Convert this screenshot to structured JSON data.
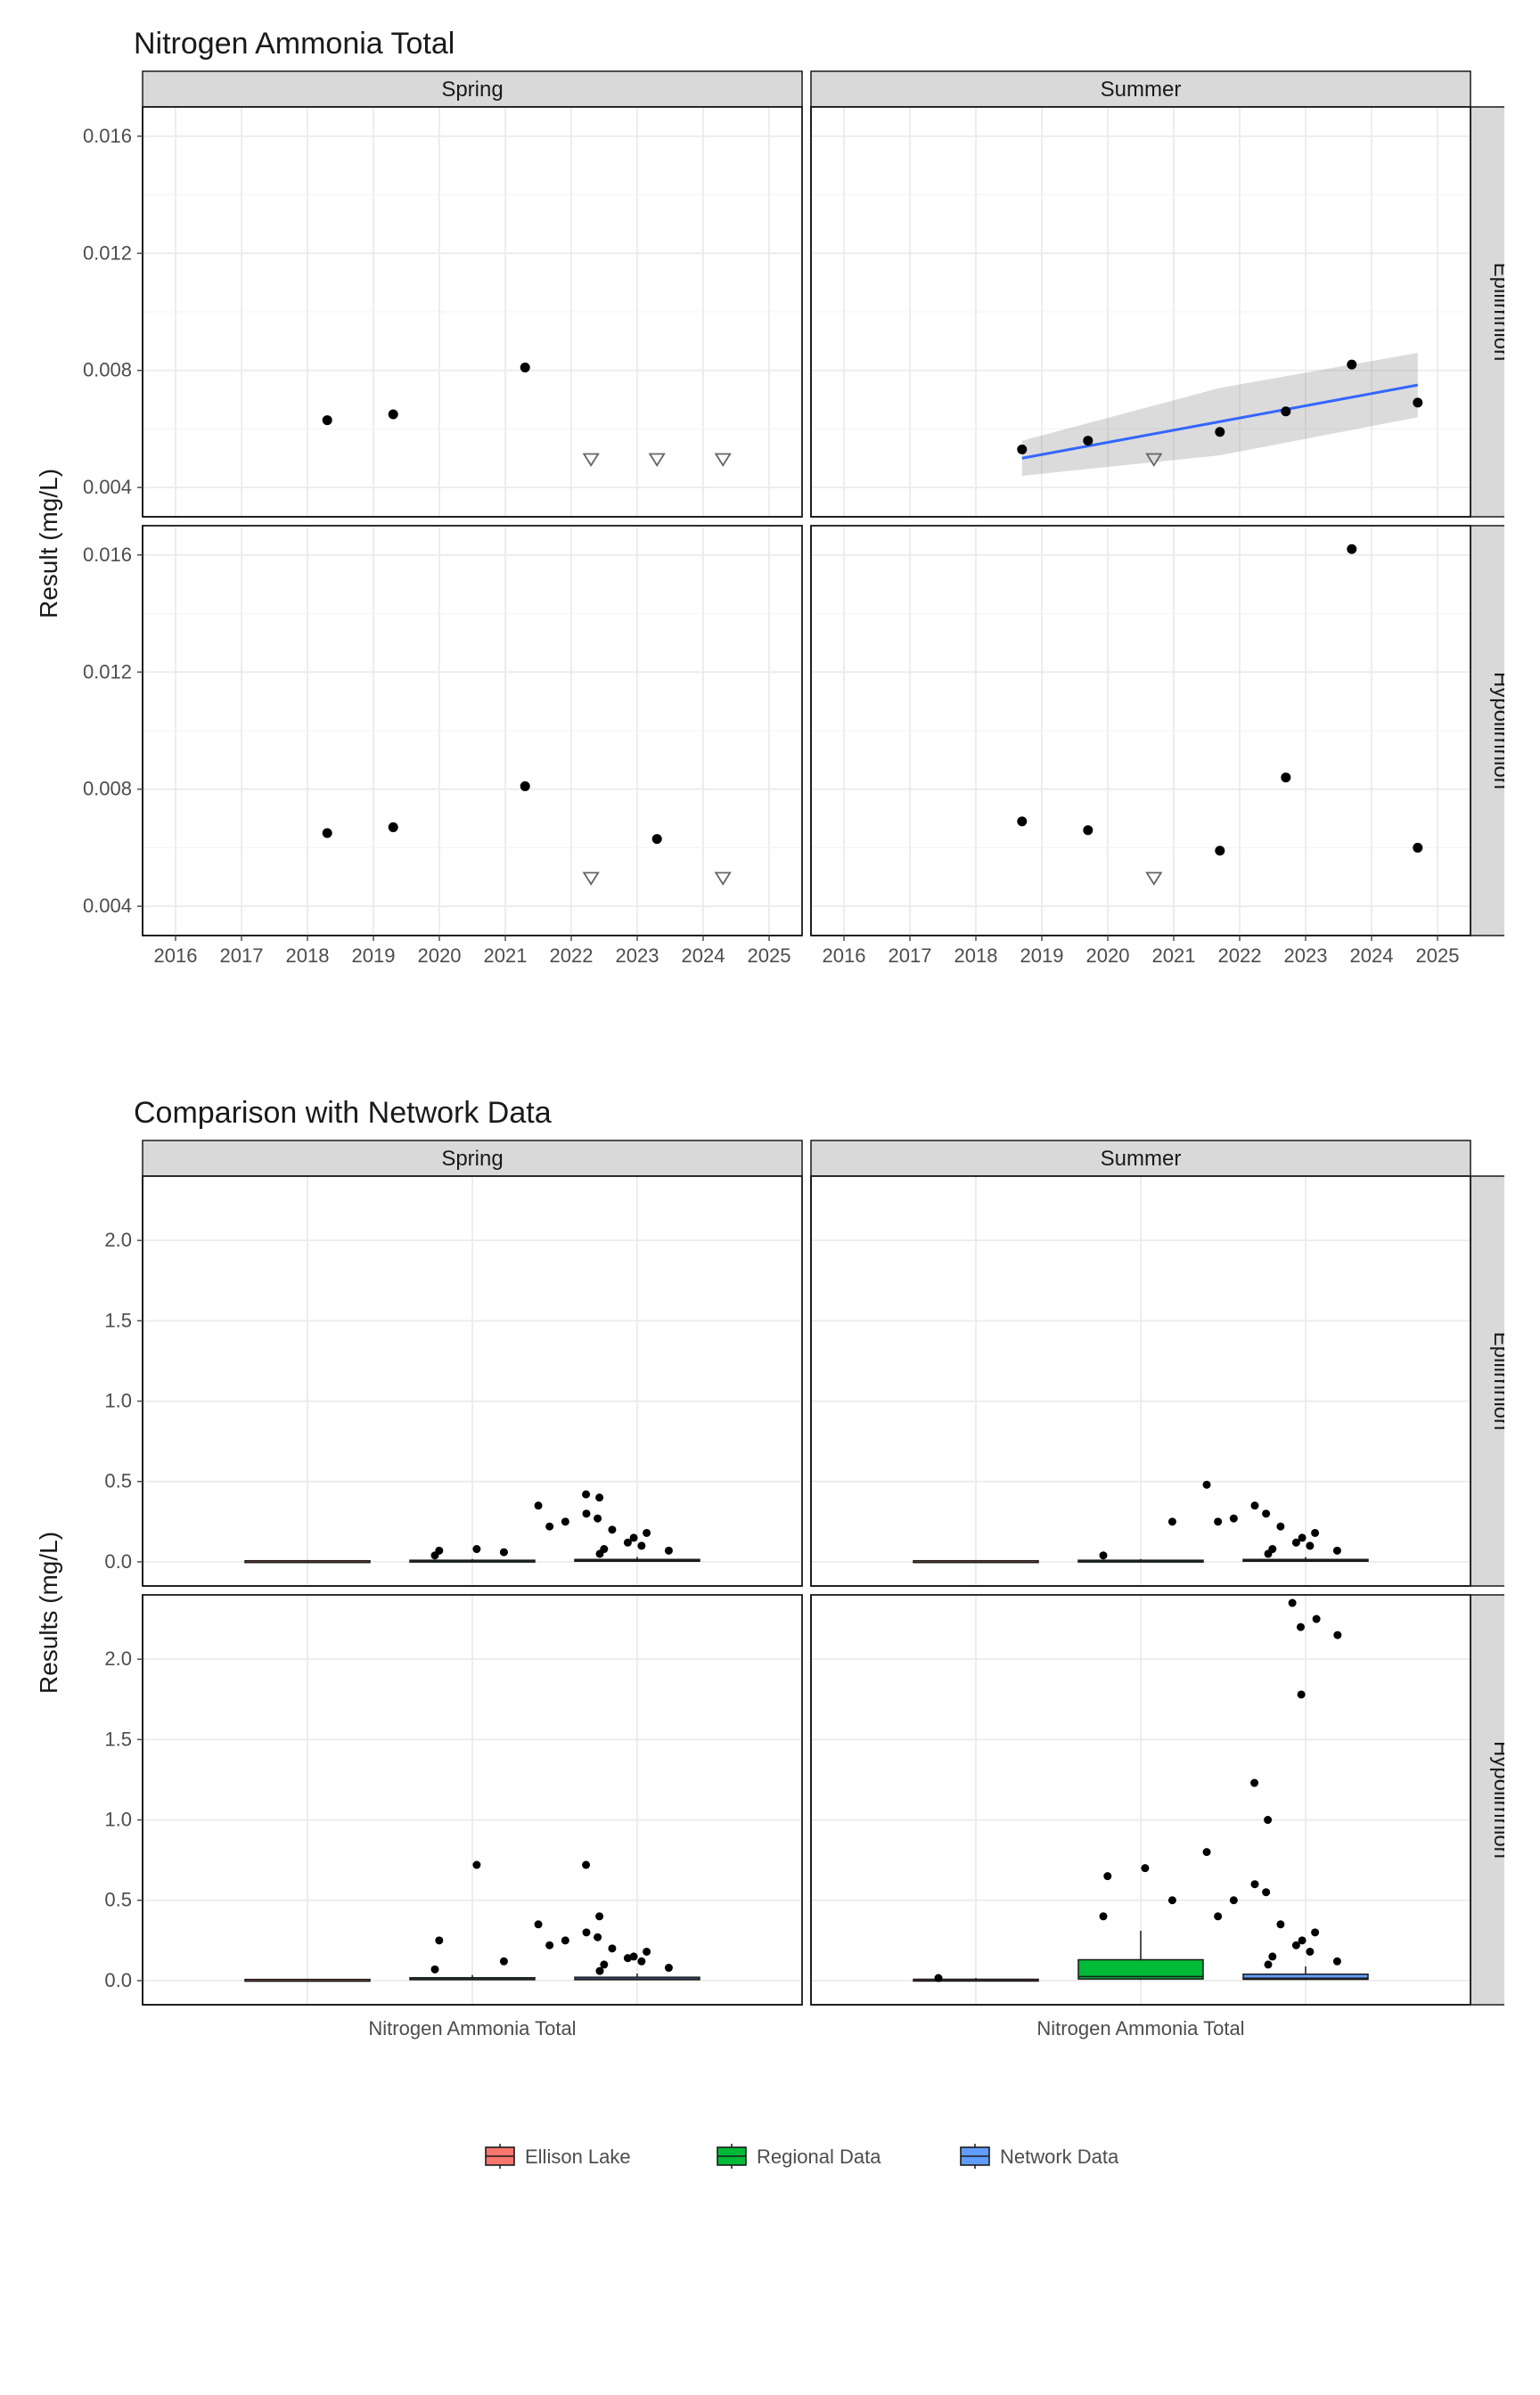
{
  "chart_data": [
    {
      "type": "scatter",
      "title": "Nitrogen Ammonia Total",
      "xlabel": "",
      "ylabel": "Result (mg/L)",
      "facets_cols": [
        "Spring",
        "Summer"
      ],
      "facets_rows": [
        "Epilimnion",
        "Hypolimnion"
      ],
      "xlim": [
        2015.5,
        2025.5
      ],
      "ylim": [
        0.003,
        0.017
      ],
      "x_ticks": [
        2016,
        2017,
        2018,
        2019,
        2020,
        2021,
        2022,
        2023,
        2024,
        2025
      ],
      "y_ticks": [
        0.004,
        0.008,
        0.012,
        0.016
      ],
      "series": [
        {
          "name": "Spring Epilimnion",
          "facet_col": "Spring",
          "facet_row": "Epilimnion",
          "points": [
            {
              "x": 2018.3,
              "y": 0.0063,
              "censored": false
            },
            {
              "x": 2019.3,
              "y": 0.0065,
              "censored": false
            },
            {
              "x": 2021.3,
              "y": 0.0081,
              "censored": false
            },
            {
              "x": 2022.3,
              "y": 0.005,
              "censored": true
            },
            {
              "x": 2023.3,
              "y": 0.005,
              "censored": true
            },
            {
              "x": 2024.3,
              "y": 0.005,
              "censored": true
            }
          ]
        },
        {
          "name": "Summer Epilimnion",
          "facet_col": "Summer",
          "facet_row": "Epilimnion",
          "points": [
            {
              "x": 2018.7,
              "y": 0.0053,
              "censored": false
            },
            {
              "x": 2019.7,
              "y": 0.0056,
              "censored": false
            },
            {
              "x": 2020.7,
              "y": 0.005,
              "censored": true
            },
            {
              "x": 2021.7,
              "y": 0.0059,
              "censored": false
            },
            {
              "x": 2022.7,
              "y": 0.0066,
              "censored": false
            },
            {
              "x": 2023.7,
              "y": 0.0082,
              "censored": false
            },
            {
              "x": 2024.7,
              "y": 0.0069,
              "censored": false
            }
          ],
          "trend": {
            "x": [
              2018.7,
              2024.7
            ],
            "y": [
              0.005,
              0.0075
            ],
            "se_lower": [
              0.0044,
              0.0064
            ],
            "se_upper": [
              0.0056,
              0.0086
            ]
          }
        },
        {
          "name": "Spring Hypolimnion",
          "facet_col": "Spring",
          "facet_row": "Hypolimnion",
          "points": [
            {
              "x": 2018.3,
              "y": 0.0065,
              "censored": false
            },
            {
              "x": 2019.3,
              "y": 0.0067,
              "censored": false
            },
            {
              "x": 2021.3,
              "y": 0.0081,
              "censored": false
            },
            {
              "x": 2022.3,
              "y": 0.005,
              "censored": true
            },
            {
              "x": 2023.3,
              "y": 0.0063,
              "censored": false
            },
            {
              "x": 2024.3,
              "y": 0.005,
              "censored": true
            }
          ]
        },
        {
          "name": "Summer Hypolimnion",
          "facet_col": "Summer",
          "facet_row": "Hypolimnion",
          "points": [
            {
              "x": 2018.7,
              "y": 0.0069,
              "censored": false
            },
            {
              "x": 2019.7,
              "y": 0.0066,
              "censored": false
            },
            {
              "x": 2020.7,
              "y": 0.005,
              "censored": true
            },
            {
              "x": 2021.7,
              "y": 0.0059,
              "censored": false
            },
            {
              "x": 2022.7,
              "y": 0.0084,
              "censored": false
            },
            {
              "x": 2023.7,
              "y": 0.0162,
              "censored": false
            },
            {
              "x": 2024.7,
              "y": 0.006,
              "censored": false
            }
          ]
        }
      ]
    },
    {
      "type": "boxplot",
      "title": "Comparison with Network Data",
      "xlabel": "",
      "ylabel": "Results (mg/L)",
      "facets_cols": [
        "Spring",
        "Summer"
      ],
      "facets_rows": [
        "Epilimnion",
        "Hypolimnion"
      ],
      "x_categories_label": "Nitrogen Ammonia Total",
      "groups": [
        "Ellison Lake",
        "Regional Data",
        "Network Data"
      ],
      "ylim": [
        -0.15,
        2.4
      ],
      "y_ticks": [
        0.0,
        0.5,
        1.0,
        1.5,
        2.0
      ],
      "legend_colors": {
        "Ellison Lake": "#f8766d",
        "Regional Data": "#00ba38",
        "Network Data": "#619cff"
      },
      "data": {
        "Spring|Epilimnion": {
          "Ellison Lake": {
            "min": 0.005,
            "q1": 0.005,
            "median": 0.006,
            "q3": 0.007,
            "max": 0.008,
            "outliers": []
          },
          "Regional Data": {
            "min": 0.003,
            "q1": 0.005,
            "median": 0.007,
            "q3": 0.01,
            "max": 0.018,
            "outliers": [
              0.04,
              0.06,
              0.07,
              0.08
            ]
          },
          "Network Data": {
            "min": 0.002,
            "q1": 0.005,
            "median": 0.008,
            "q3": 0.015,
            "max": 0.03,
            "outliers": [
              0.05,
              0.07,
              0.08,
              0.1,
              0.12,
              0.15,
              0.18,
              0.2,
              0.22,
              0.25,
              0.27,
              0.3,
              0.35,
              0.4,
              0.42
            ]
          }
        },
        "Summer|Epilimnion": {
          "Ellison Lake": {
            "min": 0.005,
            "q1": 0.0053,
            "median": 0.0059,
            "q3": 0.007,
            "max": 0.0082,
            "outliers": []
          },
          "Regional Data": {
            "min": 0.003,
            "q1": 0.005,
            "median": 0.007,
            "q3": 0.01,
            "max": 0.018,
            "outliers": [
              0.04,
              0.25
            ]
          },
          "Network Data": {
            "min": 0.002,
            "q1": 0.005,
            "median": 0.008,
            "q3": 0.015,
            "max": 0.03,
            "outliers": [
              0.05,
              0.07,
              0.08,
              0.1,
              0.12,
              0.15,
              0.18,
              0.22,
              0.25,
              0.27,
              0.3,
              0.35,
              0.48
            ]
          }
        },
        "Spring|Hypolimnion": {
          "Ellison Lake": {
            "min": 0.005,
            "q1": 0.005,
            "median": 0.0065,
            "q3": 0.0075,
            "max": 0.0081,
            "outliers": []
          },
          "Regional Data": {
            "min": 0.003,
            "q1": 0.006,
            "median": 0.009,
            "q3": 0.018,
            "max": 0.035,
            "outliers": [
              0.07,
              0.12,
              0.25,
              0.72
            ]
          },
          "Network Data": {
            "min": 0.002,
            "q1": 0.006,
            "median": 0.01,
            "q3": 0.021,
            "max": 0.044,
            "outliers": [
              0.06,
              0.08,
              0.1,
              0.12,
              0.14,
              0.15,
              0.18,
              0.2,
              0.22,
              0.25,
              0.27,
              0.3,
              0.35,
              0.4,
              0.72
            ]
          }
        },
        "Summer|Hypolimnion": {
          "Ellison Lake": {
            "min": 0.005,
            "q1": 0.0059,
            "median": 0.0066,
            "q3": 0.0084,
            "max": 0.0162,
            "outliers": [
              0.016
            ]
          },
          "Regional Data": {
            "min": 0.004,
            "q1": 0.01,
            "median": 0.025,
            "q3": 0.13,
            "max": 0.31,
            "outliers": [
              0.4,
              0.5,
              0.65,
              0.7
            ]
          },
          "Network Data": {
            "min": 0.003,
            "q1": 0.008,
            "median": 0.015,
            "q3": 0.04,
            "max": 0.088,
            "outliers": [
              0.1,
              0.12,
              0.15,
              0.18,
              0.22,
              0.25,
              0.3,
              0.35,
              0.4,
              0.5,
              0.55,
              0.6,
              0.8,
              1.0,
              1.23,
              1.78,
              2.15,
              2.2,
              2.25,
              2.35
            ]
          }
        }
      }
    }
  ],
  "titles": {
    "chart1": "Nitrogen Ammonia Total",
    "chart2": "Comparison with Network Data"
  },
  "axis_labels": {
    "y1": "Result (mg/L)",
    "y2": "Results (mg/L)"
  },
  "facet_labels": {
    "col1": "Spring",
    "col2": "Summer",
    "row1": "Epilimnion",
    "row2": "Hypolimnion"
  },
  "x_cat_label": "Nitrogen Ammonia Total",
  "legend": {
    "g1": "Ellison Lake",
    "g2": "Regional Data",
    "g3": "Network Data"
  }
}
